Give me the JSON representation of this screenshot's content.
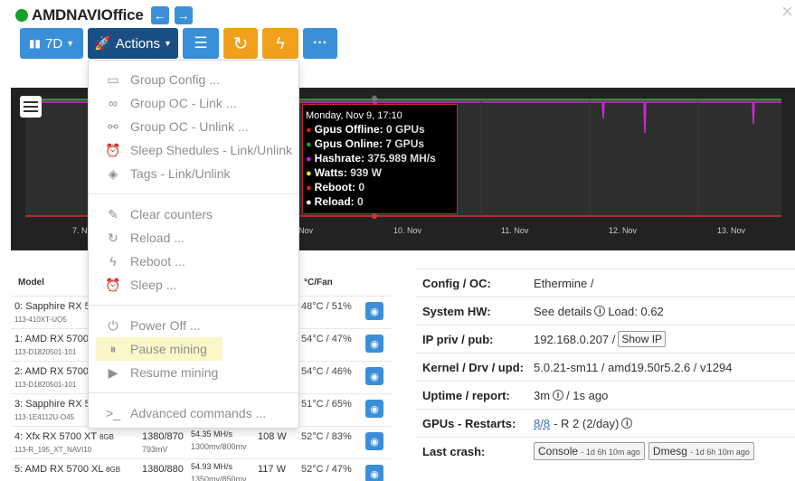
{
  "header": {
    "rig_name": "AMDNAVIOffice",
    "close": "×"
  },
  "toolbar": {
    "range_label": "7D",
    "actions_label": "Actions"
  },
  "chart_tooltip": {
    "time": "Monday, Nov 9, 17:10",
    "rows": [
      {
        "label": "Gpus Offline:",
        "value": "0 GPUs",
        "color": "#e21b1b"
      },
      {
        "label": "Gpus Online:",
        "value": "7 GPUs",
        "color": "#1a9e2f"
      },
      {
        "label": "Hashrate:",
        "value": "375.989 MH/s",
        "color": "#c21fd6"
      },
      {
        "label": "Watts:",
        "value": "939 W",
        "color": "#e6e61c"
      },
      {
        "label": "Reboot:",
        "value": "0",
        "color": "#e21b1b"
      },
      {
        "label": "Reload:",
        "value": "0",
        "color": "#ffffff"
      }
    ]
  },
  "chart_ticks": [
    "7. N",
    "Nov",
    "10. Nov",
    "11. Nov",
    "12. Nov",
    "13. Nov"
  ],
  "actions_menu": [
    {
      "label": "Group Config ...",
      "icon": "group-config-icon",
      "glyph": "▭"
    },
    {
      "label": "Group OC - Link ...",
      "icon": "link-icon",
      "glyph": "∞"
    },
    {
      "label": "Group OC - Unlink ...",
      "icon": "unlink-icon",
      "glyph": "⚯"
    },
    {
      "label": "Sleep Shedules - Link/Unlink",
      "icon": "alarm-clock-icon",
      "glyph": "⏰"
    },
    {
      "label": "Tags - Link/Unlink",
      "icon": "tags-icon",
      "glyph": "◈"
    },
    {
      "label": "Clear counters",
      "icon": "broom-icon",
      "glyph": "✎"
    },
    {
      "label": "Reload ...",
      "icon": "reload-icon",
      "glyph": "↻"
    },
    {
      "label": "Reboot ...",
      "icon": "bolt-icon",
      "glyph": "ϟ"
    },
    {
      "label": "Sleep ...",
      "icon": "alarm-clock-icon",
      "glyph": "⏰"
    },
    {
      "label": "Power Off ...",
      "icon": "power-icon",
      "glyph": "⏻"
    },
    {
      "label": "Pause mining",
      "icon": "pause-icon",
      "glyph": "⏸"
    },
    {
      "label": "Resume mining",
      "icon": "play-icon",
      "glyph": "▶"
    },
    {
      "label": "Advanced commands ...",
      "icon": "terminal-icon",
      "glyph": ">_"
    }
  ],
  "gpu_table": {
    "headers": {
      "model": "Model",
      "temp_fan": "°C/Fan"
    },
    "rows": [
      {
        "name": "0: Sapphire RX 5",
        "mem": "",
        "sub": "113-410XT-UO5",
        "clk": "",
        "mv": "",
        "hr": "",
        "hr2": "",
        "w": "",
        "temp": "48°C / 51%"
      },
      {
        "name": "1: AMD RX 5700 X",
        "mem": "",
        "sub": "113-D1820501-101",
        "clk": "",
        "mv": "",
        "hr": "",
        "hr2": "",
        "w": "",
        "temp": "54°C / 47%"
      },
      {
        "name": "2: AMD RX 5700 X",
        "mem": "",
        "sub": "113-D1820501-101",
        "clk": "",
        "mv": "",
        "hr": "",
        "hr2": "",
        "w": "",
        "temp": "54°C / 46%"
      },
      {
        "name": "3: Sapphire RX 5",
        "mem": "",
        "sub": "113-1E4112U-O45",
        "clk": "",
        "mv": "",
        "hr": "",
        "hr2": "",
        "w": "",
        "temp": "51°C / 65%"
      },
      {
        "name": "4: Xfx RX 5700 XT",
        "mem": "8GB",
        "sub": "113-R_195_XT_NAVI10",
        "clk": "1380/870",
        "mv": "793mV",
        "hr": "54.35 MH/s",
        "hr2": "1300mv/800mv",
        "w": "108 W",
        "temp": "52°C / 83%"
      },
      {
        "name": "5: AMD RX 5700 XL",
        "mem": "8GB",
        "sub": "",
        "clk": "1380/880",
        "mv": "",
        "hr": "54.93 MH/s",
        "hr2": "1350mv/850mv",
        "w": "117 W",
        "temp": "52°C / 47%"
      }
    ]
  },
  "info": {
    "config_label": "Config / OC:",
    "config_val": "Ethermine /",
    "hw_label": "System HW:",
    "hw_val": "See details",
    "hw_load": "Load: 0.62",
    "ip_label": "IP priv / pub:",
    "ip_val": "192.168.0.207 /",
    "show_ip": "Show IP",
    "kernel_label": "Kernel / Drv / upd:",
    "kernel_val": "5.0.21-sm11 / amd19.50r5.2.6 / v1294",
    "uptime_label": "Uptime / report:",
    "uptime_a": "3m",
    "uptime_b": "/ 1s ago",
    "gpus_label": "GPUs - Restarts:",
    "gpus_link": "8/8",
    "gpus_val": "- R 2 (2/day)",
    "crash_label": "Last crash:",
    "console_label": "Console",
    "console_ago": "- 1d 6h 10m ago",
    "dmesg_label": "Dmesg",
    "dmesg_ago": "- 1d 6h 10m ago"
  }
}
